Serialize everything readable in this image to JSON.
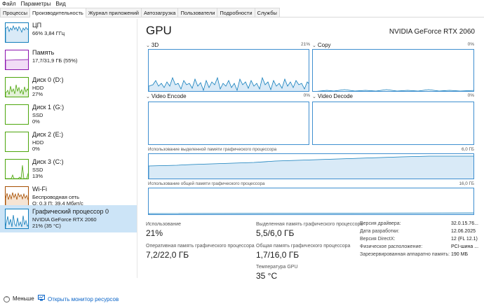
{
  "menu": [
    "Файл",
    "Параметры",
    "Вид"
  ],
  "tabs": [
    "Процессы",
    "Производительность",
    "Журнал приложений",
    "Автозагрузка",
    "Пользователи",
    "Подробности",
    "Службы"
  ],
  "active_tab": 1,
  "sidebar": [
    {
      "title": "ЦП",
      "line2": "66% 3,84 ГГц",
      "line3": "",
      "color": "#117dbb"
    },
    {
      "title": "Память",
      "line2": "17,7/31,9 ГБ (55%)",
      "line3": "",
      "color": "#8b12ae"
    },
    {
      "title": "Диск 0 (D:)",
      "line2": "HDD",
      "line3": "27%",
      "color": "#4da60c"
    },
    {
      "title": "Диск 1 (G:)",
      "line2": "SSD",
      "line3": "0%",
      "color": "#4da60c"
    },
    {
      "title": "Диск 2 (E:)",
      "line2": "HDD",
      "line3": "0%",
      "color": "#4da60c"
    },
    {
      "title": "Диск 3 (C:)",
      "line2": "SSD",
      "line3": "13%",
      "color": "#4da60c"
    },
    {
      "title": "Wi-Fi",
      "line2": "Беспроводная сеть",
      "line3": "О: 0,3  П: 39,4 Мбит/с",
      "color": "#a74f01"
    },
    {
      "title": "Графический процессор 0",
      "line2": "NVIDIA GeForce RTX 2060",
      "line3": "21% (35 °C)",
      "color": "#117dbb"
    }
  ],
  "gpu": {
    "title": "GPU",
    "name": "NVIDIA GeForce RTX 2060",
    "engines": [
      {
        "label": "3D",
        "pct": "21%"
      },
      {
        "label": "Copy",
        "pct": "0%"
      },
      {
        "label": "Video Encode",
        "pct": "0%"
      },
      {
        "label": "Video Decode",
        "pct": "0%"
      }
    ],
    "dedicated_label": "Использование выделенной памяти графического процессора",
    "dedicated_max": "6,0 ГБ",
    "shared_label": "Использование общей памяти графического процессора",
    "shared_max": "16,0 ГБ"
  },
  "stats": {
    "util_label": "Использование",
    "util_value": "21%",
    "dedicated_label": "Выделенная память графического процессора",
    "dedicated_value": "5,5/6,0 ГБ",
    "gpu_mem_label": "Оперативная память графического процессора",
    "gpu_mem_value": "7,2/22,0 ГБ",
    "shared_label": "Общая память графического процессора",
    "shared_value": "1,7/16,0 ГБ",
    "temp_label": "Температура GPU",
    "temp_value": "35 °C"
  },
  "info": [
    {
      "k": "Версия драйвера:",
      "v": "32.0.15.76..."
    },
    {
      "k": "Дата разработки:",
      "v": "12.06.2025"
    },
    {
      "k": "Версия DirectX:",
      "v": "12 (FL 12.1)"
    },
    {
      "k": "Физическое расположение:",
      "v": "PCI-шина ..."
    },
    {
      "k": "Зарезервированная аппаратно память:",
      "v": "190 МБ"
    }
  ],
  "bottom": {
    "less": "Меньше",
    "monitor": "Открыть монитор ресурсов"
  },
  "icons": {
    "less": "chevron-up-icon",
    "monitor": "resource-monitor-icon"
  }
}
